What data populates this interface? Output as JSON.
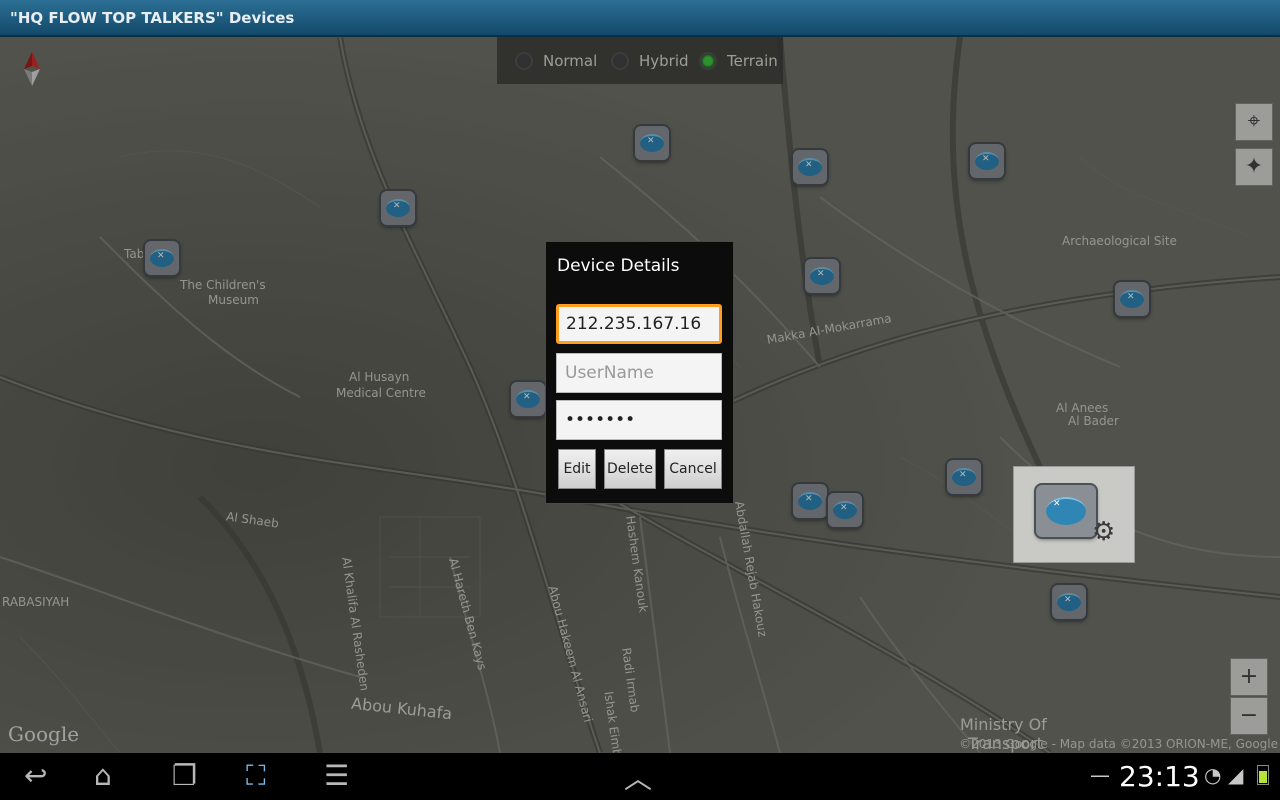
{
  "app": {
    "title": "\"HQ FLOW TOP TALKERS\" Devices"
  },
  "map_type": {
    "options": [
      {
        "label": "Normal",
        "selected": false
      },
      {
        "label": "Hybrid",
        "selected": false
      },
      {
        "label": "Terrain",
        "selected": true
      }
    ]
  },
  "map": {
    "labels": [
      "The Children's",
      "Museum",
      "Al Husayn",
      "Medical Centre",
      "Archaeological Site",
      "Makka Al-Mokarrama",
      "Al Anees",
      "Al Bader",
      "Al Shaeb",
      "RABASIYAH",
      "Abou Kuhafa",
      "Abou Hakeem Al Ansari",
      "Abdallah Rejab Hakouz",
      "Hashem Kanouk",
      "Radi Irmab",
      "Ishak Eimb",
      "Al Hareth Ben Kays",
      "Al Khalifa Al Rasheden",
      "Ministry Of",
      "Transport",
      "Tab"
    ],
    "logo": "Google",
    "attribution": "©2013 Google - Map data ©2013 ORION-ME, Google"
  },
  "controls": {
    "my_location_icon": "crosshair-icon",
    "compass_icon": "compass-icon",
    "zoom_in": "+",
    "zoom_out": "−"
  },
  "dialog": {
    "title": "Device Details",
    "ip_value": "212.235.167.16",
    "username_placeholder": "UserName",
    "password_value": "•••••••",
    "buttons": {
      "edit": "Edit",
      "delete": "Delete",
      "cancel": "Cancel"
    }
  },
  "statusbar": {
    "time": "23:13"
  },
  "colors": {
    "titlebar": "#1f5d82",
    "focus": "#ff9d1e",
    "router": "#2f86b5"
  }
}
